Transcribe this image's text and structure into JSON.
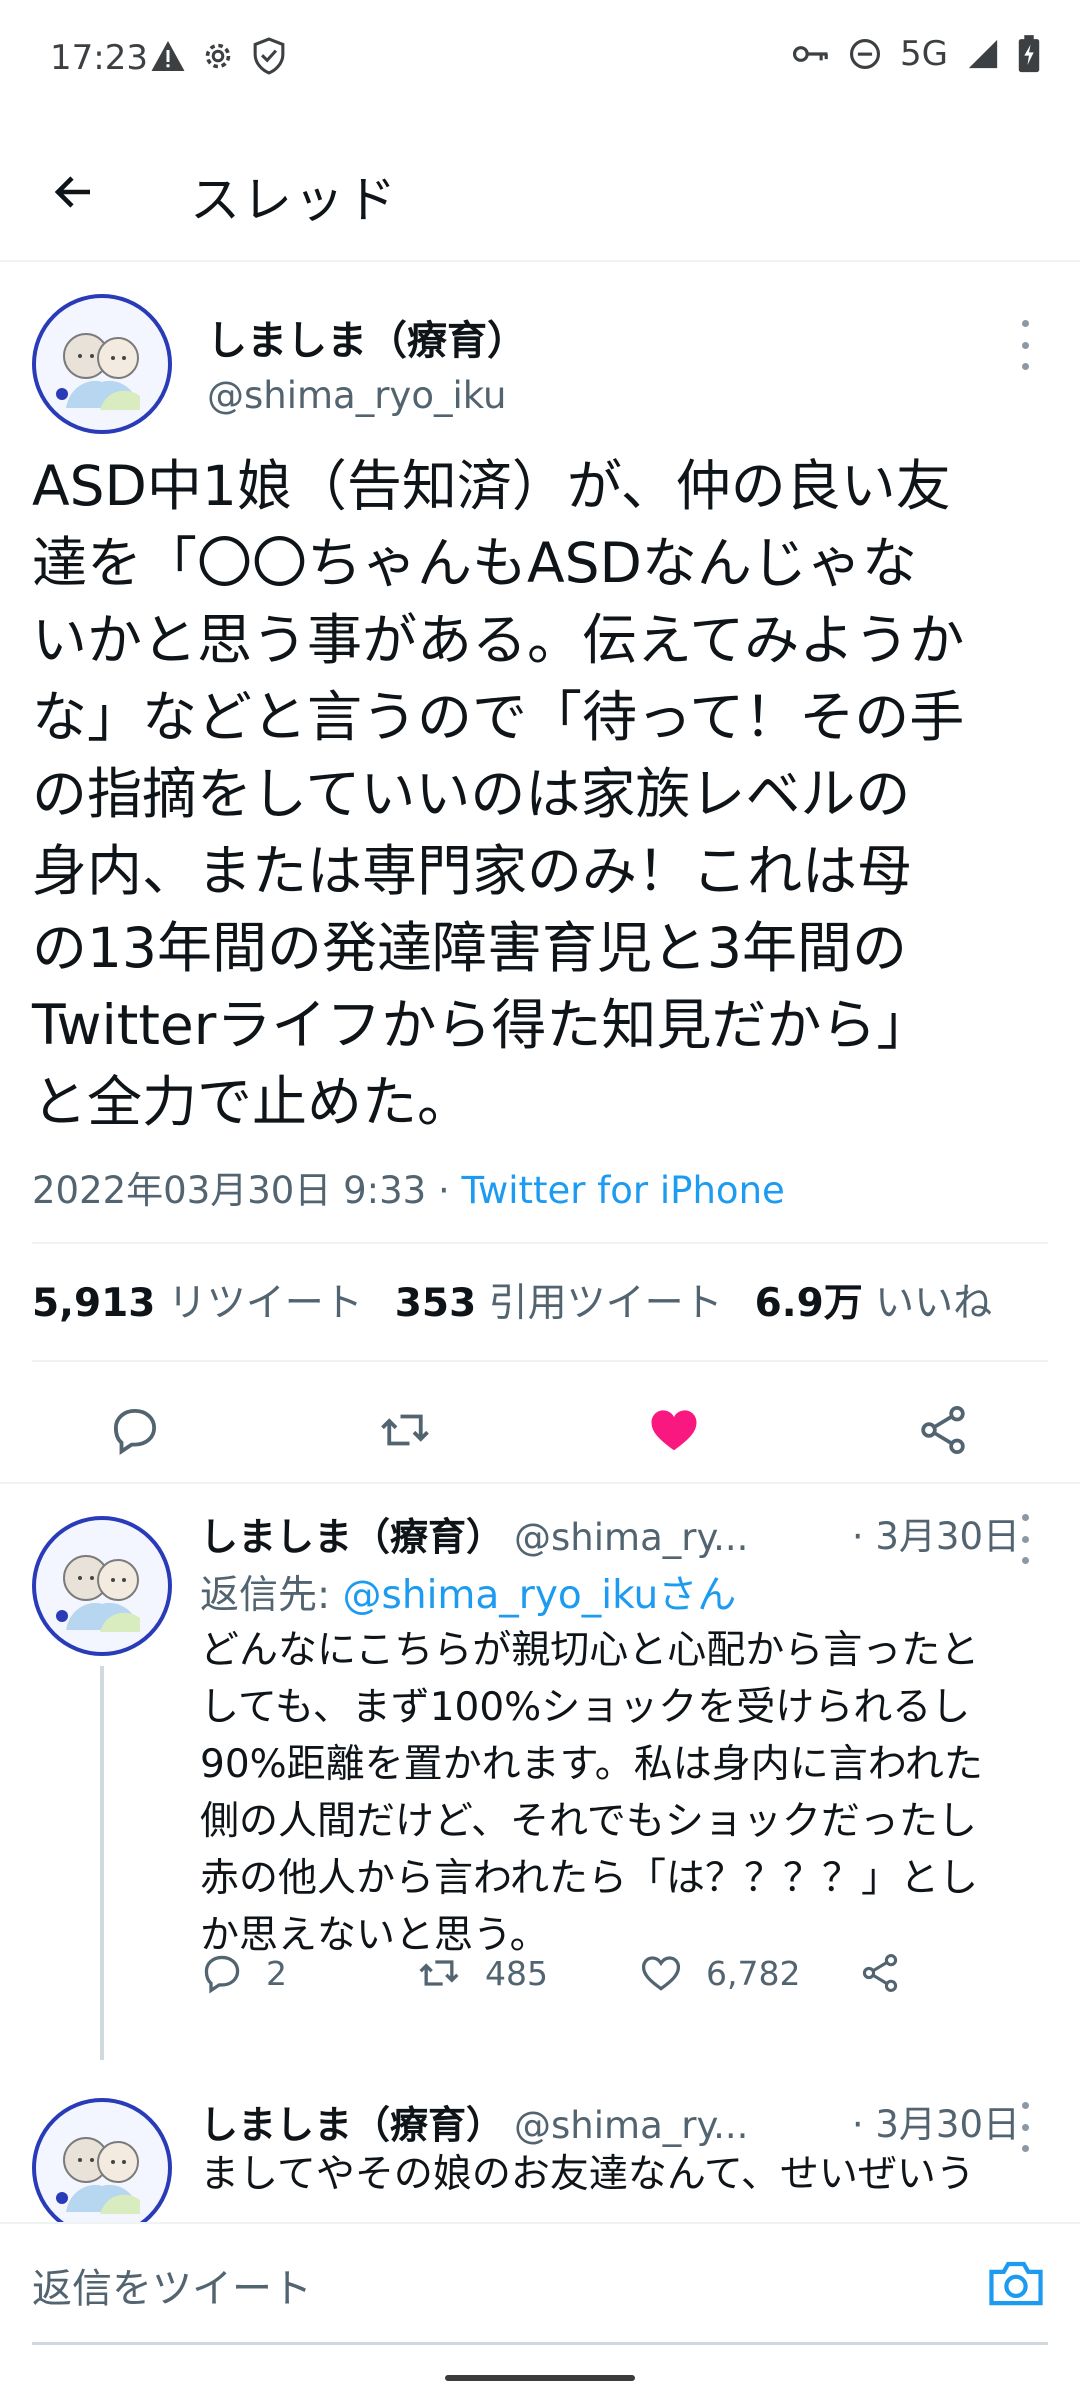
{
  "status_bar": {
    "time": "17:23",
    "network": "5G",
    "icons": [
      "warning-icon",
      "gear-icon",
      "shield-icon",
      "key-icon",
      "dnd-icon",
      "signal-icon",
      "battery-icon"
    ]
  },
  "header": {
    "title": "スレッド",
    "back_icon": "arrow-left-icon"
  },
  "main_tweet": {
    "name": "しましま（療育）",
    "handle": "@shima_ryo_iku",
    "text": "ASD中1娘（告知済）が、仲の良い友\n達を「〇〇ちゃんもASDなんじゃな\nいかと思う事がある。伝えてみようか\nな」などと言うので「待って！その手\nの指摘をしていいのは家族レベルの\n身内、または専門家のみ！これは母\nの13年間の発達障害育児と3年間の\nTwitterライフから得た知見だから」\nと全力で止めた。",
    "timestamp": "2022年03月30日 9:33",
    "separator": " · ",
    "source": "Twitter for iPhone",
    "stats": {
      "retweets_count": "5,913",
      "retweets_label": "リツイート",
      "quotes_count": "353",
      "quotes_label": "引用ツイート",
      "likes_count": "6.9万",
      "likes_label": "いいね"
    },
    "liked": true,
    "colors": {
      "like": "#f91880",
      "link": "#1d9bf0",
      "secondary": "#536471"
    }
  },
  "replies": [
    {
      "name": "しましま（療育）",
      "handle": "@shima_ry...",
      "date": "· 3月30日",
      "reply_to_label": "返信先: ",
      "reply_to_handle": "@shima_ryo_ikuさん",
      "text": "どんなにこちらが親切心と心配から言ったと\nしても、まず100%ショックを受けられるし\n90%距離を置かれます。私は身内に言われた\n側の人間だけど、それでもショックだったし\n赤の他人から言われたら「は？？？？」とし\nか思えないと思う。",
      "replies_count": "2",
      "retweets_count": "485",
      "likes_count": "6,782"
    },
    {
      "name": "しましま（療育）",
      "handle": "@shima_ry...",
      "date": "· 3月30日",
      "text": "ましてやその娘のお友達なんて、せいぜいう"
    }
  ],
  "compose": {
    "placeholder": "返信をツイート",
    "camera_icon": "camera-icon"
  }
}
